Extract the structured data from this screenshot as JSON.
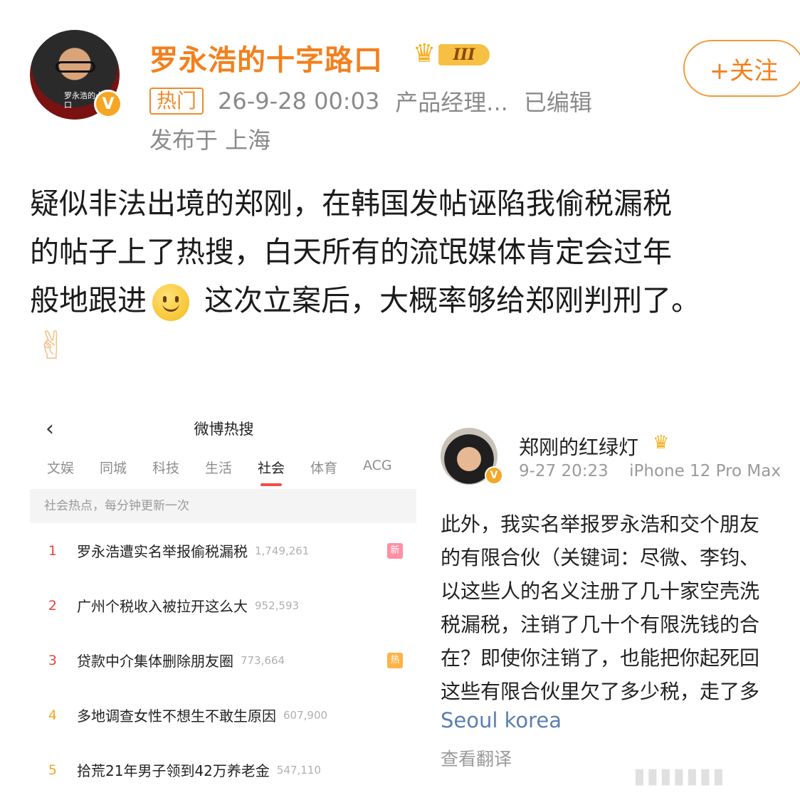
{
  "author": {
    "name": "罗永浩的十字路口",
    "avatar_caption": "罗永浩的十字路口",
    "level_badge": "III",
    "follow_label": "+关注"
  },
  "meta": {
    "hot_tag": "热门",
    "time": "26-9-28 00:03",
    "source": "产品经理...",
    "edited": "已编辑",
    "location": "发布于 上海"
  },
  "post": {
    "line1": "疑似非法出境的郑刚，在韩国发帖诬陷我偷税漏税",
    "line2": "的帖子上了热搜，白天所有的流氓媒体肯定会过年",
    "line3a": "般地跟进",
    "line3b": " 这次立案后，大概率够给郑刚判刑了。",
    "emoji_after": "✌"
  },
  "hot_search": {
    "title": "微博热搜",
    "tabs": [
      "文娱",
      "同城",
      "科技",
      "生活",
      "社会",
      "体育",
      "ACG"
    ],
    "active_tab": "社会",
    "subtitle": "社会热点，每分钟更新一次",
    "items": [
      {
        "rank": "1",
        "topic": "罗永浩遭实名举报偷税漏税",
        "count": "1,749,261",
        "badge": "新",
        "badge_color": "#ff8fa3"
      },
      {
        "rank": "2",
        "topic": "广州个税收入被拉开这么大",
        "count": "952,593",
        "badge": "",
        "badge_color": ""
      },
      {
        "rank": "3",
        "topic": "贷款中介集体删除朋友圈",
        "count": "773,664",
        "badge": "热",
        "badge_color": "#ffb347"
      },
      {
        "rank": "4",
        "topic": "多地调查女性不想生不敢生原因",
        "count": "607,900",
        "badge": "",
        "badge_color": ""
      },
      {
        "rank": "5",
        "topic": "拾荒21年男子领到42万养老金",
        "count": "547,110",
        "badge": "",
        "badge_color": ""
      }
    ]
  },
  "other_post": {
    "name": "郑刚的红绿灯",
    "time": "9-27 20:23",
    "device": "iPhone 12 Pro Max",
    "lines": [
      "此外，我实名举报罗永浩和交个朋友",
      "的有限合伙（关键词：尽微、李钧、",
      "以这些人的名义注册了几十家空壳洗",
      "税漏税，注销了几十个有限洗钱的合",
      "在？即使你注销了，也能把你起死回",
      "这些有限合伙里欠了多少税，走了多"
    ],
    "location": "Seoul korea",
    "translate": "查看翻译"
  },
  "colors": {
    "brand_orange": "#f3801e",
    "hot_red": "#e8453c",
    "link_blue": "#5a7fb0"
  }
}
